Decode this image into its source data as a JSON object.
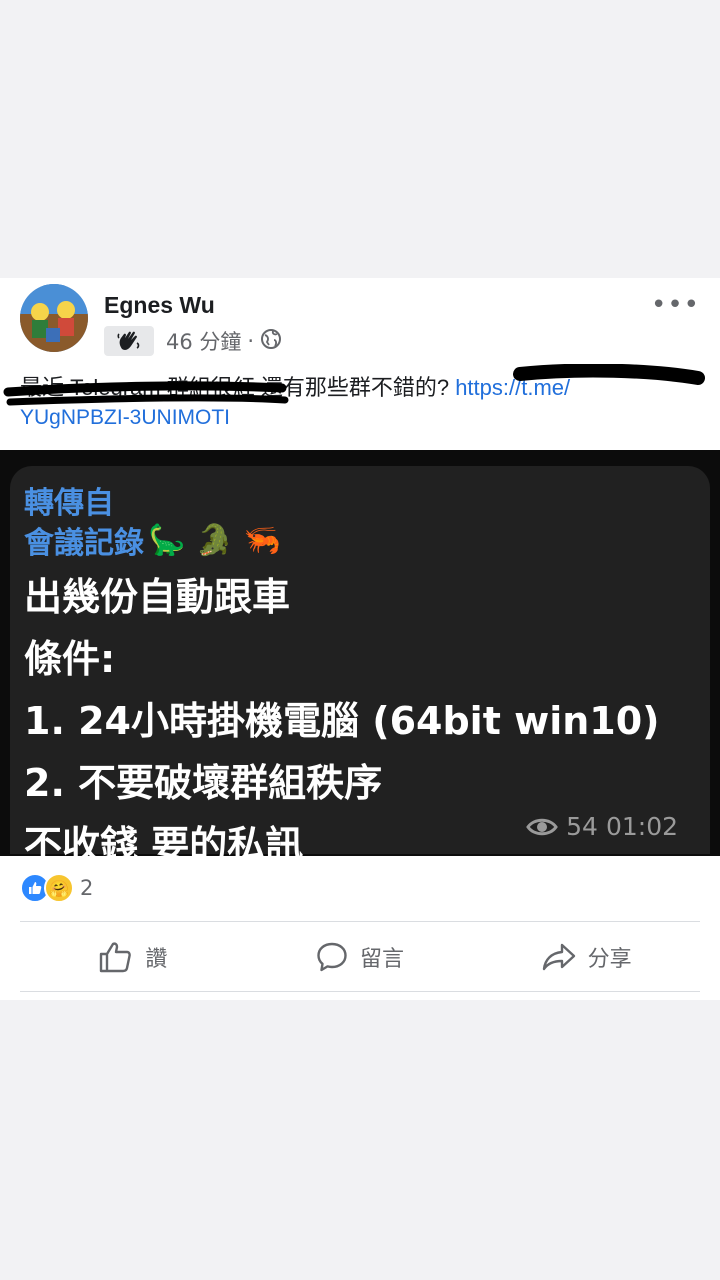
{
  "post": {
    "author": "Egnes Wu",
    "time": "46 分鐘",
    "separator": "·",
    "text": "最近 Telegram 群組很紅 還有那些群不錯的?",
    "link_line": "YUgNPBZI-3UNIMOTI",
    "icons": [
      "avatar-image",
      "wave-hand-icon",
      "globe-icon",
      "more-icon"
    ]
  },
  "telegram": {
    "forwarded_label": "轉傳自",
    "forwarded_from": "會議記錄",
    "emojis": "🦕 🐊 🦐",
    "lines": [
      "出幾份自動跟車",
      "條件:",
      "1. 24小時掛機電腦 (64bit win10)",
      "2. 不要破壞群組秩序",
      "不收錢 要的私訊"
    ],
    "views": "54",
    "time": "01:02"
  },
  "reactions": {
    "count": "2",
    "types": [
      "like",
      "care"
    ]
  },
  "actions": {
    "like": "讚",
    "comment": "留言",
    "share": "分享"
  },
  "colors": {
    "link": "#216fdb",
    "telegram_bubble": "#212121",
    "telegram_name": "#4a90e2",
    "like_blue": "#2d88ff"
  }
}
